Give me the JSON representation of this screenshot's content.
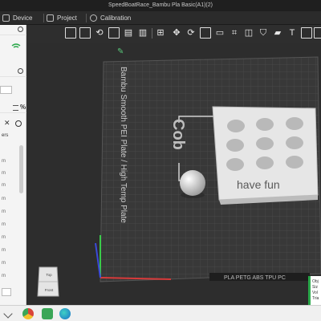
{
  "window": {
    "title": "SpeedBoatRace_Bambu Pla Basic(A1)(2)"
  },
  "tabs": [
    {
      "label": "Device"
    },
    {
      "label": "Project"
    },
    {
      "label": "Calibration"
    }
  ],
  "left_panel": {
    "partial_label": "ers",
    "unit": "m"
  },
  "viewport": {
    "plate_label": "Bambu Smooth PEI Plate / High Temp Plate",
    "model_text": "have fun",
    "model_side_text": "Cob",
    "plate_footer": "PLA PETG ABS TPU PC",
    "view_cube": {
      "top": "Top",
      "front": "Front"
    }
  },
  "status_popup": {
    "lines": [
      "Obj",
      "Siz",
      "Vol",
      "Tria"
    ]
  },
  "colors": {
    "accent_green": "#2aa84a",
    "plate": "#3a3a3a",
    "grid": "#4b4b4b",
    "model": "#e6e6e6",
    "axis_x": "#d83a3a",
    "axis_y": "#3acb4a",
    "axis_z": "#3a4bdb"
  },
  "taskbar": {
    "icons": [
      "chrome-icon",
      "app-icon",
      "edge-icon"
    ]
  }
}
